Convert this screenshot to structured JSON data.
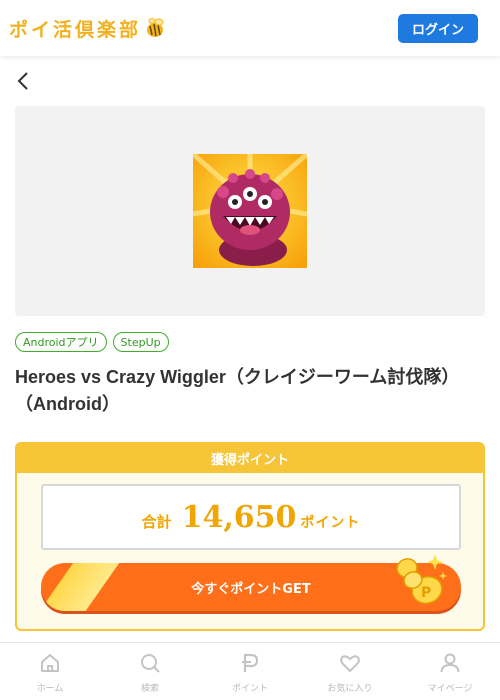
{
  "header": {
    "logo_text": "ポイ活倶楽部",
    "login_label": "ログイン"
  },
  "icons": {
    "back": "chevron-left-icon",
    "logo_mascot": "bee-icon"
  },
  "tags": [
    "Androidアプリ",
    "StepUp"
  ],
  "title": "Heroes vs Crazy Wiggler（クレイジーワーム討伐隊）（Android）",
  "points": {
    "header": "獲得ポイント",
    "total_label": "合計",
    "total_value": "14,650",
    "unit": "ポイント",
    "cta": "今すぐポイントGET"
  },
  "tabbar": [
    {
      "label": "ホーム",
      "icon": "home-icon"
    },
    {
      "label": "検索",
      "icon": "search-icon"
    },
    {
      "label": "ポイント",
      "icon": "point-icon"
    },
    {
      "label": "お気に入り",
      "icon": "heart-icon"
    },
    {
      "label": "マイページ",
      "icon": "user-icon"
    }
  ],
  "colors": {
    "accent_yellow": "#f5c537",
    "cta_orange": "#ff6f1a",
    "login_blue": "#1f7ae0",
    "tag_green": "#3fae2a"
  }
}
